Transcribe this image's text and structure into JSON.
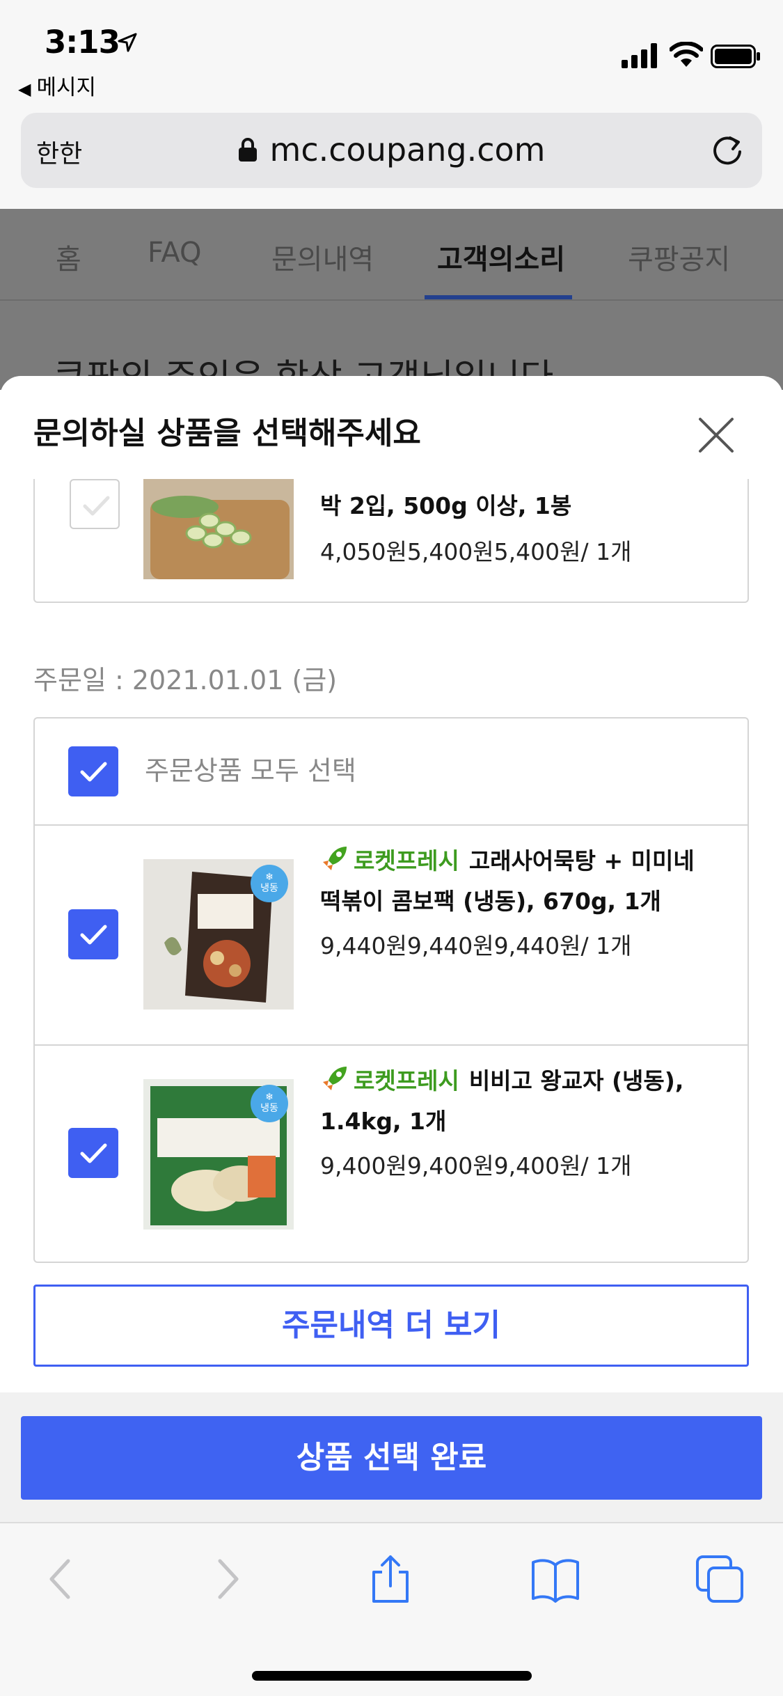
{
  "status_bar": {
    "time": "3:13",
    "back_app": "메시지"
  },
  "url_bar": {
    "aa": "한한",
    "domain": "mc.coupang.com"
  },
  "background_page": {
    "tabs": [
      "홈",
      "FAQ",
      "문의내역",
      "고객의소리",
      "쿠팡공지"
    ],
    "active_tab": "고객의소리",
    "headline": "쿠팡의 주인은 항상 고객님입니다"
  },
  "modal": {
    "title": "문의하실 상품을 선택해주세요",
    "previous_item": {
      "name": "박 2입, 500g 이상, 1봉",
      "price": "4,050원5,400원5,400원/ 1개",
      "checked": false
    },
    "order_date": "주문일 : 2021.01.01 (금)",
    "select_all_label": "주문상품 모두 선택",
    "items": [
      {
        "rocket": "로켓프레시",
        "name": "고래사어묵탕 + 미미네 떡볶이 콤보팩 (냉동), 670g, 1개",
        "price": "9,440원9,440원9,440원/ 1개",
        "badge": "냉동",
        "checked": true
      },
      {
        "rocket": "로켓프레시",
        "name": "비비고 왕교자 (냉동), 1.4kg, 1개",
        "price": "9,400원9,400원9,400원/ 1개",
        "badge": "냉동",
        "checked": true
      }
    ],
    "more_button": "주문내역 더 보기"
  },
  "complete_button": "상품 선택 완료",
  "colors": {
    "accent": "#3f5ff2",
    "rocket": "#3d9b1f"
  }
}
